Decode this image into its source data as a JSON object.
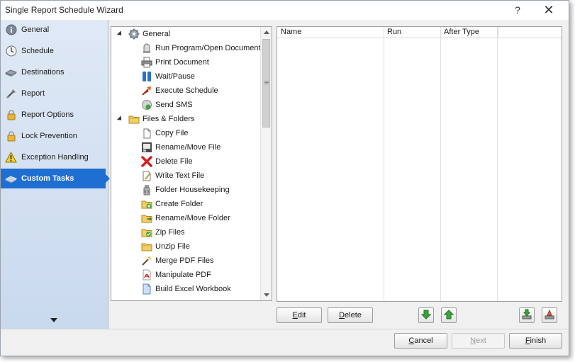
{
  "window": {
    "title": "Single Report Schedule Wizard",
    "help_label": "?",
    "close_label": "✕"
  },
  "sidebar": {
    "items": [
      {
        "label": "General",
        "icon": "info-icon",
        "active": false
      },
      {
        "label": "Schedule",
        "icon": "clock-icon",
        "active": false
      },
      {
        "label": "Destinations",
        "icon": "destinations-icon",
        "active": false
      },
      {
        "label": "Report",
        "icon": "report-icon",
        "active": false
      },
      {
        "label": "Report Options",
        "icon": "lock-icon",
        "active": false
      },
      {
        "label": "Lock Prevention",
        "icon": "lock-icon",
        "active": false
      },
      {
        "label": "Exception Handling",
        "icon": "warning-icon",
        "active": false
      },
      {
        "label": "Custom Tasks",
        "icon": "tasks-icon",
        "active": true
      }
    ]
  },
  "tree": {
    "groups": [
      {
        "label": "General",
        "icon": "gear-icon",
        "items": [
          {
            "label": "Run Program/Open Document",
            "icon": "run-program-icon"
          },
          {
            "label": "Print Document",
            "icon": "printer-icon"
          },
          {
            "label": "Wait/Pause",
            "icon": "pause-icon"
          },
          {
            "label": "Execute Schedule",
            "icon": "execute-icon"
          },
          {
            "label": "Send SMS",
            "icon": "sms-icon"
          }
        ]
      },
      {
        "label": "Files & Folders",
        "icon": "folder-icon",
        "items": [
          {
            "label": "Copy File",
            "icon": "copy-file-icon"
          },
          {
            "label": "Rename/Move File",
            "icon": "rename-file-icon"
          },
          {
            "label": "Delete File",
            "icon": "delete-icon"
          },
          {
            "label": "Write Text File",
            "icon": "write-text-icon"
          },
          {
            "label": "Folder Housekeeping",
            "icon": "housekeeping-icon"
          },
          {
            "label": "Create Folder",
            "icon": "create-folder-icon"
          },
          {
            "label": "Rename/Move Folder",
            "icon": "rename-folder-icon"
          },
          {
            "label": "Zip Files",
            "icon": "zip-icon"
          },
          {
            "label": "Unzip File",
            "icon": "unzip-icon"
          },
          {
            "label": "Merge PDF Files",
            "icon": "merge-pdf-icon"
          },
          {
            "label": "Manipulate PDF",
            "icon": "pdf-icon"
          },
          {
            "label": "Build Excel Workbook",
            "icon": "excel-icon"
          }
        ]
      }
    ]
  },
  "grid": {
    "columns": [
      "Name",
      "Run",
      "After Type",
      ""
    ]
  },
  "actions": {
    "edit_label": "Edit",
    "delete_label": "Delete"
  },
  "footer": {
    "cancel_label": "Cancel",
    "next_label": "Next",
    "finish_label": "Finish"
  },
  "colors": {
    "active_nav": "#1f6ed1",
    "sidebar_top": "#dfe9f6",
    "sidebar_bottom": "#c9d9ee"
  }
}
